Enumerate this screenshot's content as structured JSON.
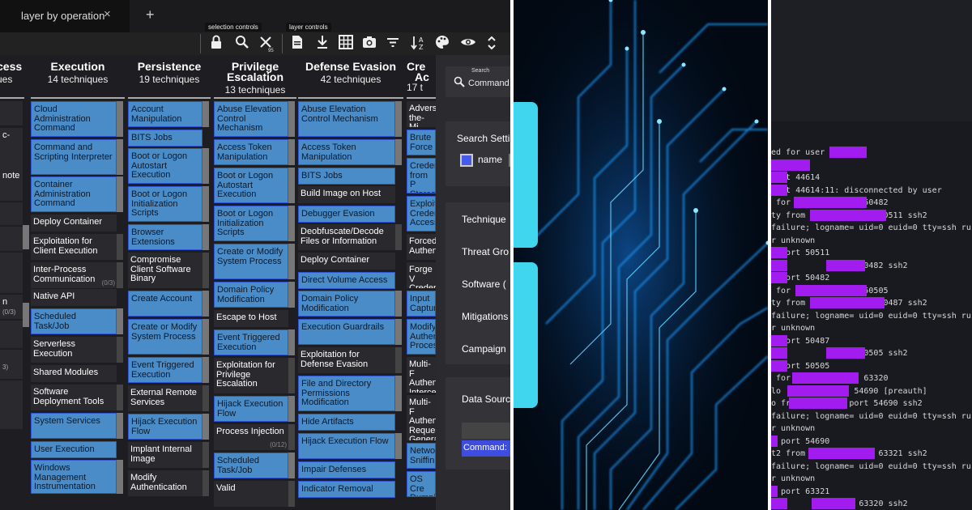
{
  "left_panel": {
    "tab": {
      "title": "layer by operation",
      "close": "×",
      "add": "+"
    },
    "toolbar": {
      "group_selection": "selection controls",
      "group_layer": "layer controls",
      "icons": [
        "lock-icon",
        "search-icon",
        "close-icon",
        "file-icon",
        "download-icon",
        "grid-icon",
        "camera-icon",
        "filter-icon",
        "sort-icon",
        "palette-icon",
        "eye-icon",
        "expand-icon"
      ],
      "close_badge": "95"
    },
    "columns": [
      {
        "name": "Execution",
        "count": "14 techniques"
      },
      {
        "name": "Persistence",
        "count": "19 techniques"
      },
      {
        "name": "Privilege Escalation",
        "count": "13 techniques"
      },
      {
        "name": "Defense Evasion",
        "count": "42 techniques"
      }
    ],
    "partial_columns": {
      "left_title": "cess",
      "left_sub": "ues",
      "right_title": "Cre",
      "right_title2": "Ac",
      "right_sub": "17 t"
    },
    "left_strip": [
      "c-",
      "note",
      "n",
      "(0/3)",
      "3)"
    ],
    "execution": [
      "Cloud Administration Command",
      "Command and Scripting Interpreter",
      "Container Administration Command",
      "Deploy Container",
      "Exploitation for Client Execution",
      "Inter-Process Communication",
      "Native API",
      "Scheduled Task/Job",
      "Serverless Execution",
      "Shared Modules",
      "Software Deployment Tools",
      "System Services",
      "User Execution",
      "Windows Management Instrumentation"
    ],
    "execution_counts": {
      "ipc": "(0/3)"
    },
    "persistence": [
      "Account Manipulation",
      "BITS Jobs",
      "Boot or Logon Autostart Execution",
      "Boot or Logon Initialization Scripts",
      "Browser Extensions",
      "Compromise Client Software Binary",
      "Create Account",
      "Create or Modify System Process",
      "Event Triggered Execution",
      "External Remote Services",
      "Hijack Execution Flow",
      "Implant Internal Image",
      "Modify Authentication"
    ],
    "privilege": [
      "Abuse Elevation Control Mechanism",
      "Access Token Manipulation",
      "Boot or Logon Autostart Execution",
      "Boot or Logon Initialization Scripts",
      "Create or Modify System Process",
      "Domain Policy Modification",
      "Escape to Host",
      "Event Triggered Execution",
      "Exploitation for Privilege Escalation",
      "Hijack Execution Flow",
      "Process Injection",
      "Scheduled Task/Job",
      "Valid"
    ],
    "privilege_counts": {
      "process_injection": "(0/12)"
    },
    "defense": [
      "Abuse Elevation Control Mechanism",
      "Access Token Manipulation",
      "BITS Jobs",
      "Build Image on Host",
      "Debugger Evasion",
      "Deobfuscate/Decode Files or Information",
      "Deploy Container",
      "Direct Volume Access",
      "Domain Policy Modification",
      "Execution Guardrails",
      "Exploitation for Defense Evasion",
      "File and Directory Permissions Modification",
      "Hide Artifacts",
      "Hijack Execution Flow",
      "Impair Defenses",
      "Indicator Removal"
    ],
    "cred_partial": [
      "Advers the-Mi",
      "Brute Force",
      "Creden from P Stores",
      "Exploit Creden Access",
      "Forced Authen",
      "Forge V Creden",
      "Input Captur",
      "Modify Authen Proces",
      "Multi-F Authen Interce",
      "Multi-F Authen Reques Genera",
      "Netwo Sniffin",
      "OS Cre Dumpi"
    ],
    "search_panel": {
      "search_label": "Search",
      "search_value": "Command I",
      "settings": "Search Setti",
      "check_name": "name",
      "sections": [
        "Technique",
        "Threat Gro",
        "Software (",
        "Mitigations",
        "Campaign"
      ],
      "data_source": "Data Sourc",
      "command_chip": "Command:"
    }
  },
  "right_panel": {
    "lines": [
      "ed for user",
      "",
      "port 44614",
      "port 44614:11: disconnected by user",
      " for          port 50482",
      "ty from          port 50511 ssh2",
      "failure; logname= uid=0 euid=0 tty=ssh ruser",
      "r unknown",
      "  port 50511",
      "rom          port 50482 ssh2",
      "  port 50482",
      " for          port 50505",
      "ty from          port 50487 ssh2",
      "failure; logname= uid=0 euid=0 tty=ssh ruser",
      "r unknown",
      "  port 50487",
      "rom          port 50505 ssh2",
      "  port 50505",
      " for          port 63320",
      "lo          port 54690 [preauth]",
      "o from          port 54690 ssh2",
      "failure; logname= uid=0 euid=0 tty=ssh ruser",
      "r unknown",
      "  port 54690",
      "t2 from          port 63321 ssh2",
      "failure; logname= uid=0 euid=0 tty=ssh ruser",
      "r unknown",
      "  port 63321",
      "rom          port 63320 ssh2"
    ]
  }
}
